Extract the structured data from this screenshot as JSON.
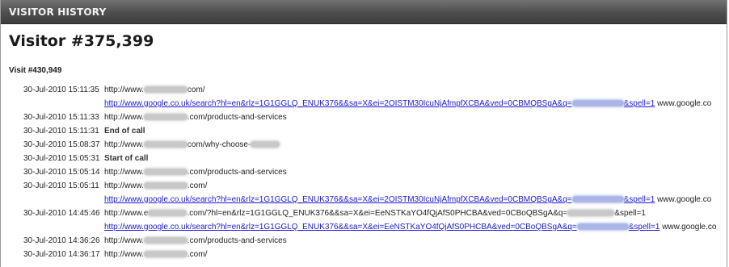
{
  "window": {
    "title": "VISITOR HISTORY"
  },
  "visitor": {
    "title": "Visitor #375,399"
  },
  "visit": {
    "label": "Visit #430,949"
  },
  "entries": [
    {
      "time": "30-Jul-2010 15:11:35",
      "url_pre": "http://www.",
      "url_post": "com/"
    },
    {
      "ref_pre": "http://www.google.co.uk/search?hl=en&rlz=1G1GGLQ_ENUK376&&sa=X&ei=2OISTM30IcuNjAfmpfXCBA&ved=0CBMQBSgA&q=",
      "ref_post": "&spell=1",
      "ref_tail": "www.google.co"
    },
    {
      "time": "30-Jul-2010 15:11:33",
      "url_pre": "http://www.",
      "url_post": ".com/products-and-services"
    },
    {
      "time": "30-Jul-2010 15:11:31",
      "event": "End of call"
    },
    {
      "time": "30-Jul-2010 15:08:37",
      "url_pre": "http://www.",
      "url_post": "com/why-choose-"
    },
    {
      "time": "30-Jul-2010 15:05:31",
      "event": "Start of call"
    },
    {
      "time": "30-Jul-2010 15:05:14",
      "url_pre": "http://www.",
      "url_post": ".com/products-and-services"
    },
    {
      "time": "30-Jul-2010 15:05:11",
      "url_pre": "http://www.",
      "url_post": ".com/"
    },
    {
      "ref_pre": "http://www.google.co.uk/search?hl=en&rlz=1G1GGLQ_ENUK376&&sa=X&ei=2OISTM30IcuNjAfmpfXCBA&ved=0CBMQBSgA&q=",
      "ref_post": "&spell=1",
      "ref_tail": "www.google.co"
    },
    {
      "time": "30-Jul-2010 14:45:46",
      "url_pre": "http://www.e",
      "url_post": ".com/?hl=en&rlz=1G1GGLQ_ENUK376&&sa=X&ei=EeNSTKaYO4fQjAfS0PHCBA&ved=0CBoQBSgA&q=",
      "url_post2": "&spell=1"
    },
    {
      "ref_pre": "http://www.google.co.uk/search?hl=en&rlz=1G1GGLQ_ENUK376&&sa=X&ei=EeNSTKaYO4fQjAfS0PHCBA&ved=0CBoQBSgA&q=",
      "ref_post": "&spell=1",
      "ref_tail": "www.google.co"
    },
    {
      "time": "30-Jul-2010 14:36:26",
      "url_pre": "http://www.",
      "url_post": ".com/products-and-services"
    },
    {
      "time": "30-Jul-2010 14:36:17",
      "url_pre": "http://www.",
      "url_post": ".com/"
    }
  ]
}
